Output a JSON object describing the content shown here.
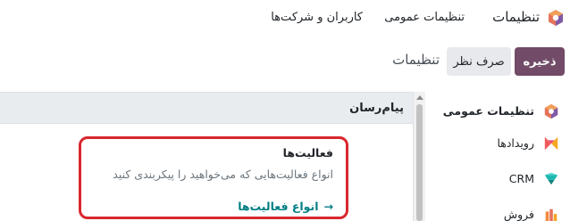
{
  "navbar": {
    "app_icon": "odoo-settings-logo-icon",
    "app_title": "تنظیمات",
    "menus": [
      "تنظیمات عمومی",
      "کاربران و شرکت‌ها"
    ]
  },
  "control_panel": {
    "save_label": "ذخیره",
    "discard_label": "صرف نظر",
    "breadcrumb": "تنظیمات"
  },
  "sidebar": {
    "items": [
      {
        "label": "تنظیمات عمومی",
        "icon": "general-settings-icon",
        "active": true
      },
      {
        "label": "رویدادها",
        "icon": "events-icon"
      },
      {
        "label": "CRM",
        "icon": "crm-icon"
      },
      {
        "label": "فروش",
        "icon": "sales-icon"
      }
    ]
  },
  "section": {
    "title": "پیام‌رسان"
  },
  "setting": {
    "title": "فعالیت‌ها",
    "description": "انواع فعالیت‌هایی که می‌خواهید را پیکربندی کنید",
    "link_label": "انواع فعالیت‌ها",
    "link_icon": "arrow-right-icon"
  },
  "colors": {
    "primary": "#714b67",
    "highlight_border": "#d9272e",
    "link": "#017e84"
  }
}
